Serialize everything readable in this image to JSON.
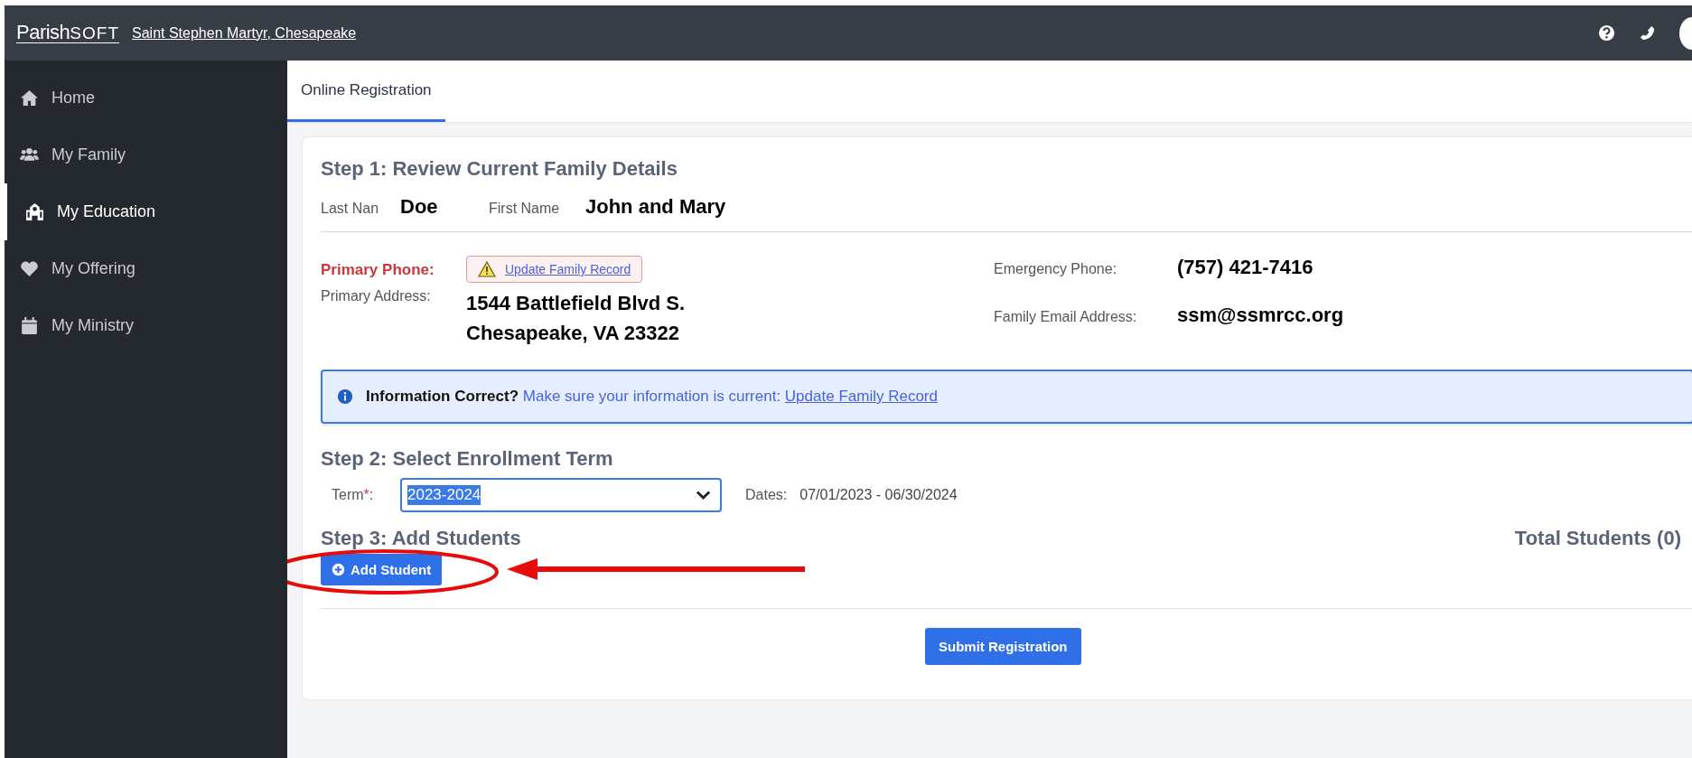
{
  "header": {
    "logo_text": "Parish",
    "logo_suffix": "SOFT",
    "parish_link": "Saint Stephen Martyr, Chesapeake"
  },
  "sidebar": {
    "items": [
      {
        "label": "Home",
        "kind": "home",
        "selected": false
      },
      {
        "label": "My Family",
        "kind": "users",
        "selected": false
      },
      {
        "label": "My Education",
        "kind": "school",
        "selected": true
      },
      {
        "label": "My Offering",
        "kind": "heart",
        "selected": false
      },
      {
        "label": "My Ministry",
        "kind": "calendar",
        "selected": false
      }
    ]
  },
  "tabs": [
    {
      "label": "Online Registration",
      "selected": true
    }
  ],
  "step1": {
    "title": "Step 1: Review Current Family Details",
    "last_name_label": "Last Nan",
    "last_name": "Doe",
    "first_name_label": "First Name",
    "first_name": "John and Mary",
    "primary_phone_label": "Primary Phone:",
    "phone_warning_link": "Update Family Record",
    "primary_address_label": "Primary Address:",
    "address_lines": [
      "1544 Battlefield Blvd S.",
      "Chesapeake, VA 23322"
    ],
    "emergency_phone_label": "Emergency Phone:",
    "emergency_phone": "(757) 421-7416",
    "email_label": "Family Email Address:",
    "email": "ssm@ssmrcc.org"
  },
  "alert": {
    "title": "Information Correct?",
    "text": "Make sure your information is current:",
    "link": "Update Family Record"
  },
  "step2": {
    "title": "Step 2: Select Enrollment Term",
    "term_label": "Term",
    "required_mark": "*",
    "label_suffix": ":",
    "term_value": "2023-2024",
    "dates_label": "Dates:",
    "dates": "07/01/2023 - 06/30/2024"
  },
  "step3": {
    "title": "Step 3: Add Students",
    "total": "Total Students (0)",
    "add_button": "Add Student"
  },
  "submit_button": "Submit Registration"
}
